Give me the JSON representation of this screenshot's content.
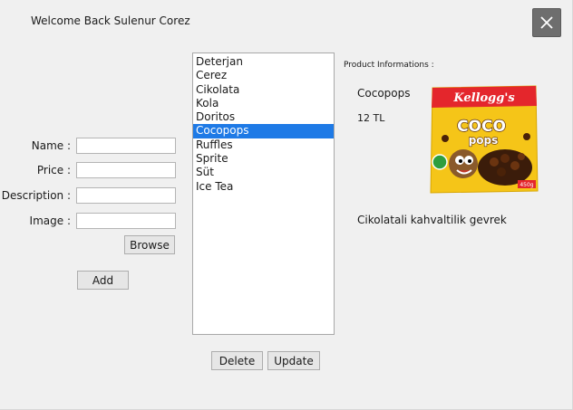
{
  "header": {
    "welcome": "Welcome Back Sulenur Corez"
  },
  "form": {
    "name_label": "Name :",
    "price_label": "Price :",
    "description_label": "Description :",
    "image_label": "Image :",
    "name_value": "",
    "price_value": "",
    "description_value": "",
    "image_value": "",
    "browse_label": "Browse",
    "add_label": "Add"
  },
  "products": {
    "items": [
      "Deterjan",
      "Cerez",
      "Cikolata",
      "Kola",
      "Doritos",
      "Cocopops",
      "Ruffles",
      "Sprite",
      "Süt",
      "Ice Tea"
    ],
    "selected_index": 5
  },
  "actions": {
    "delete_label": "Delete",
    "update_label": "Update"
  },
  "details": {
    "title": "Product Informations :",
    "name": "Cocopops",
    "price": "12 TL",
    "description": "Cikolatali kahvaltilik gevrek",
    "image_brand": "Kellogg's",
    "image_title_1": "COCO",
    "image_title_2": "pops",
    "image_weight": "450g"
  },
  "colors": {
    "selection": "#1e7ae6",
    "close_bg": "#6e6e6e",
    "window_bg": "#f0f0f0"
  }
}
